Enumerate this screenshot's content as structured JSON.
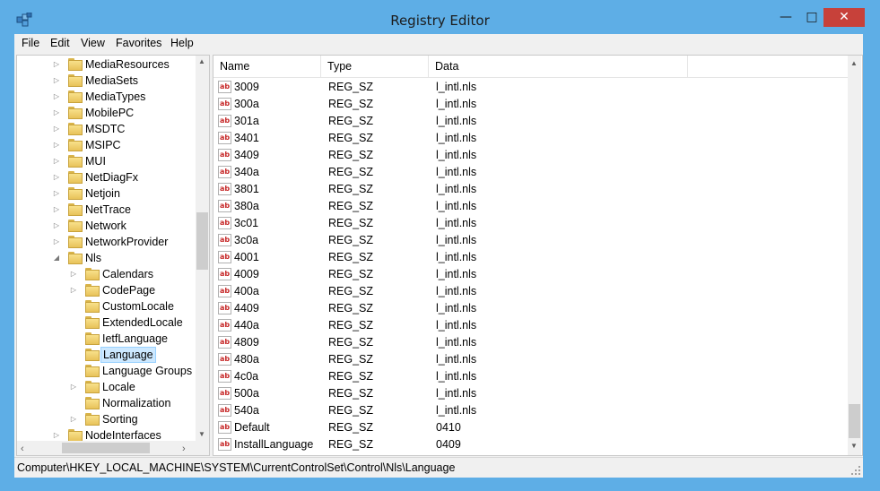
{
  "window": {
    "title": "Registry Editor",
    "controls": {
      "minimize": "—",
      "maximize": "□",
      "close": "✕"
    }
  },
  "menu": [
    "File",
    "Edit",
    "View",
    "Favorites",
    "Help"
  ],
  "tree": [
    {
      "label": "MediaResources",
      "level": 0,
      "expander": "collapsed"
    },
    {
      "label": "MediaSets",
      "level": 0,
      "expander": "collapsed"
    },
    {
      "label": "MediaTypes",
      "level": 0,
      "expander": "collapsed"
    },
    {
      "label": "MobilePC",
      "level": 0,
      "expander": "collapsed"
    },
    {
      "label": "MSDTC",
      "level": 0,
      "expander": "collapsed"
    },
    {
      "label": "MSIPC",
      "level": 0,
      "expander": "collapsed"
    },
    {
      "label": "MUI",
      "level": 0,
      "expander": "collapsed"
    },
    {
      "label": "NetDiagFx",
      "level": 0,
      "expander": "collapsed"
    },
    {
      "label": "Netjoin",
      "level": 0,
      "expander": "collapsed"
    },
    {
      "label": "NetTrace",
      "level": 0,
      "expander": "collapsed"
    },
    {
      "label": "Network",
      "level": 0,
      "expander": "collapsed"
    },
    {
      "label": "NetworkProvider",
      "level": 0,
      "expander": "collapsed"
    },
    {
      "label": "Nls",
      "level": 0,
      "expander": "expanded"
    },
    {
      "label": "Calendars",
      "level": 1,
      "expander": "collapsed"
    },
    {
      "label": "CodePage",
      "level": 1,
      "expander": "collapsed"
    },
    {
      "label": "CustomLocale",
      "level": 1,
      "expander": "none"
    },
    {
      "label": "ExtendedLocale",
      "level": 1,
      "expander": "none"
    },
    {
      "label": "IetfLanguage",
      "level": 1,
      "expander": "none"
    },
    {
      "label": "Language",
      "level": 1,
      "expander": "none",
      "selected": true
    },
    {
      "label": "Language Groups",
      "level": 1,
      "expander": "none"
    },
    {
      "label": "Locale",
      "level": 1,
      "expander": "collapsed"
    },
    {
      "label": "Normalization",
      "level": 1,
      "expander": "none"
    },
    {
      "label": "Sorting",
      "level": 1,
      "expander": "collapsed"
    },
    {
      "label": "NodeInterfaces",
      "level": 0,
      "expander": "collapsed"
    }
  ],
  "list": {
    "columns": [
      "Name",
      "Type",
      "Data"
    ],
    "rows": [
      {
        "icon": "ab",
        "name": "3009",
        "type": "REG_SZ",
        "data": "l_intl.nls"
      },
      {
        "icon": "ab",
        "name": "300a",
        "type": "REG_SZ",
        "data": "l_intl.nls"
      },
      {
        "icon": "ab",
        "name": "301a",
        "type": "REG_SZ",
        "data": "l_intl.nls"
      },
      {
        "icon": "ab",
        "name": "3401",
        "type": "REG_SZ",
        "data": "l_intl.nls"
      },
      {
        "icon": "ab",
        "name": "3409",
        "type": "REG_SZ",
        "data": "l_intl.nls"
      },
      {
        "icon": "ab",
        "name": "340a",
        "type": "REG_SZ",
        "data": "l_intl.nls"
      },
      {
        "icon": "ab",
        "name": "3801",
        "type": "REG_SZ",
        "data": "l_intl.nls"
      },
      {
        "icon": "ab",
        "name": "380a",
        "type": "REG_SZ",
        "data": "l_intl.nls"
      },
      {
        "icon": "ab",
        "name": "3c01",
        "type": "REG_SZ",
        "data": "l_intl.nls"
      },
      {
        "icon": "ab",
        "name": "3c0a",
        "type": "REG_SZ",
        "data": "l_intl.nls"
      },
      {
        "icon": "ab",
        "name": "4001",
        "type": "REG_SZ",
        "data": "l_intl.nls"
      },
      {
        "icon": "ab",
        "name": "4009",
        "type": "REG_SZ",
        "data": "l_intl.nls"
      },
      {
        "icon": "ab",
        "name": "400a",
        "type": "REG_SZ",
        "data": "l_intl.nls"
      },
      {
        "icon": "ab",
        "name": "4409",
        "type": "REG_SZ",
        "data": "l_intl.nls"
      },
      {
        "icon": "ab",
        "name": "440a",
        "type": "REG_SZ",
        "data": "l_intl.nls"
      },
      {
        "icon": "ab",
        "name": "4809",
        "type": "REG_SZ",
        "data": "l_intl.nls"
      },
      {
        "icon": "ab",
        "name": "480a",
        "type": "REG_SZ",
        "data": "l_intl.nls"
      },
      {
        "icon": "ab",
        "name": "4c0a",
        "type": "REG_SZ",
        "data": "l_intl.nls"
      },
      {
        "icon": "ab",
        "name": "500a",
        "type": "REG_SZ",
        "data": "l_intl.nls"
      },
      {
        "icon": "ab",
        "name": "540a",
        "type": "REG_SZ",
        "data": "l_intl.nls"
      },
      {
        "icon": "ab",
        "name": "Default",
        "type": "REG_SZ",
        "data": "0410"
      },
      {
        "icon": "ab",
        "name": "InstallLanguage",
        "type": "REG_SZ",
        "data": "0409"
      }
    ]
  },
  "status": {
    "path": "Computer\\HKEY_LOCAL_MACHINE\\SYSTEM\\CurrentControlSet\\Control\\Nls\\Language"
  },
  "colors": {
    "titlebar": "#5eaee6",
    "close": "#c7413a",
    "selection": "#cce8ff"
  }
}
